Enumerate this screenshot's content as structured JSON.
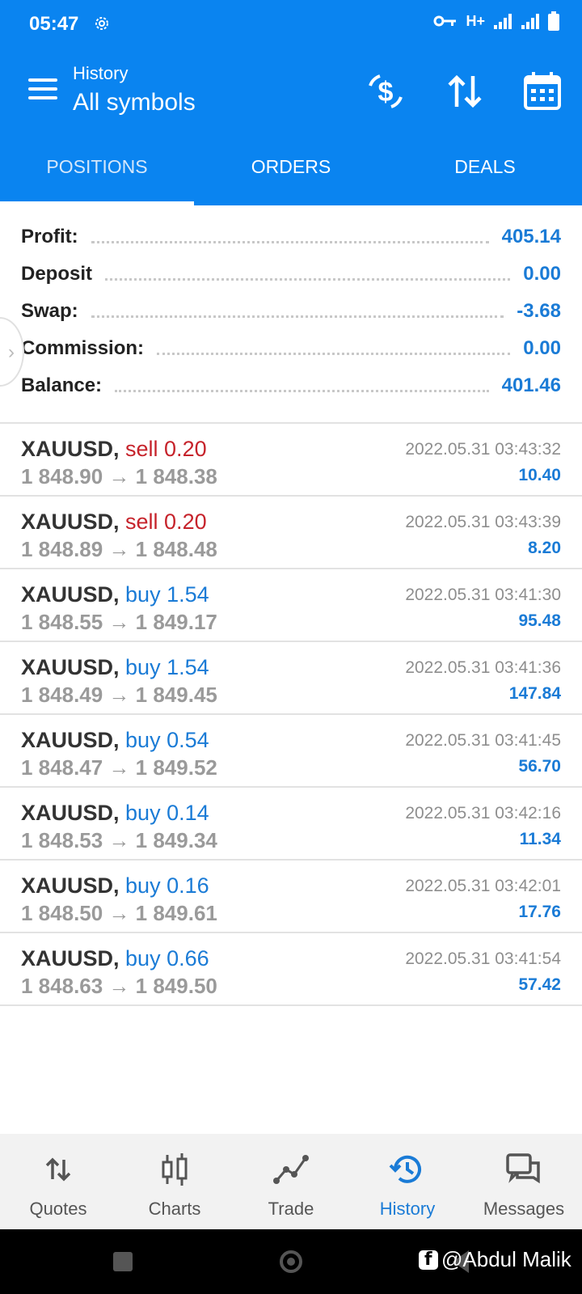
{
  "status_bar": {
    "time": "05:47",
    "network": "H+"
  },
  "app_bar": {
    "subtitle": "History",
    "title": "All symbols"
  },
  "tabs": [
    {
      "label": "POSITIONS",
      "active": true
    },
    {
      "label": "ORDERS",
      "active": false
    },
    {
      "label": "DEALS",
      "active": false
    }
  ],
  "summary": [
    {
      "label": "Profit:",
      "value": "405.14"
    },
    {
      "label": "Deposit",
      "value": "0.00"
    },
    {
      "label": "Swap:",
      "value": "-3.68"
    },
    {
      "label": "Commission:",
      "value": "0.00"
    },
    {
      "label": "Balance:",
      "value": "401.46"
    }
  ],
  "positions": [
    {
      "symbol": "XAUUSD,",
      "side": "sell",
      "volume": "sell 0.20",
      "prices": "1 848.90 → 1 848.38",
      "datetime": "2022.05.31 03:43:32",
      "profit": "10.40"
    },
    {
      "symbol": "XAUUSD,",
      "side": "sell",
      "volume": "sell 0.20",
      "prices": "1 848.89 → 1 848.48",
      "datetime": "2022.05.31 03:43:39",
      "profit": "8.20"
    },
    {
      "symbol": "XAUUSD,",
      "side": "buy",
      "volume": "buy 1.54",
      "prices": "1 848.55 → 1 849.17",
      "datetime": "2022.05.31 03:41:30",
      "profit": "95.48"
    },
    {
      "symbol": "XAUUSD,",
      "side": "buy",
      "volume": "buy 1.54",
      "prices": "1 848.49 → 1 849.45",
      "datetime": "2022.05.31 03:41:36",
      "profit": "147.84"
    },
    {
      "symbol": "XAUUSD,",
      "side": "buy",
      "volume": "buy 0.54",
      "prices": "1 848.47 → 1 849.52",
      "datetime": "2022.05.31 03:41:45",
      "profit": "56.70"
    },
    {
      "symbol": "XAUUSD,",
      "side": "buy",
      "volume": "buy 0.14",
      "prices": "1 848.53 → 1 849.34",
      "datetime": "2022.05.31 03:42:16",
      "profit": "11.34"
    },
    {
      "symbol": "XAUUSD,",
      "side": "buy",
      "volume": "buy 0.16",
      "prices": "1 848.50 → 1 849.61",
      "datetime": "2022.05.31 03:42:01",
      "profit": "17.76"
    },
    {
      "symbol": "XAUUSD,",
      "side": "buy",
      "volume": "buy 0.66",
      "prices": "1 848.63 → 1 849.50",
      "datetime": "2022.05.31 03:41:54",
      "profit": "57.42"
    }
  ],
  "bottom_nav": [
    {
      "label": "Quotes",
      "icon": "quotes-icon",
      "active": false
    },
    {
      "label": "Charts",
      "icon": "charts-icon",
      "active": false
    },
    {
      "label": "Trade",
      "icon": "trade-icon",
      "active": false
    },
    {
      "label": "History",
      "icon": "history-icon",
      "active": true
    },
    {
      "label": "Messages",
      "icon": "messages-icon",
      "active": false
    }
  ],
  "watermark": "@Abdul Malik",
  "colors": {
    "accent": "#0a84f0",
    "buy": "#1a7bd6",
    "sell": "#c6232b"
  }
}
